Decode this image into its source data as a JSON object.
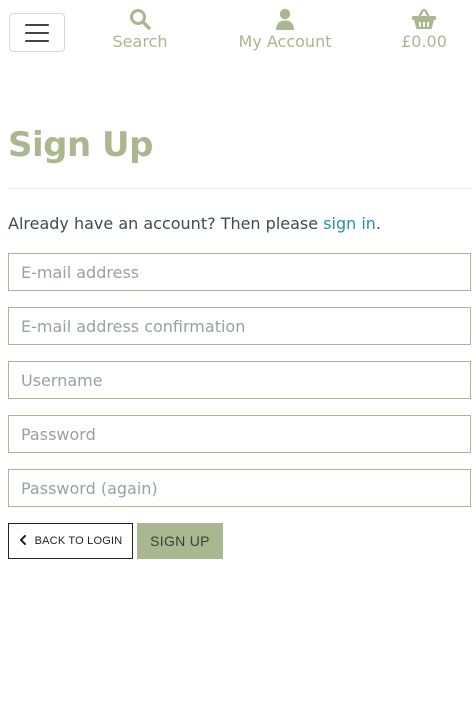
{
  "colors": {
    "accent": "#aab790",
    "link": "#2c8fa8",
    "text": "#3f4a52"
  },
  "nav": {
    "menu_icon": "hamburger-icon",
    "search": {
      "icon": "search-icon",
      "label": "Search"
    },
    "account": {
      "icon": "user-icon",
      "label": "My Account"
    },
    "bag": {
      "icon": "basket-icon",
      "label": "£0.00"
    }
  },
  "page": {
    "title": "Sign Up",
    "intro_text": "Already have an account? Then please ",
    "intro_link": "sign in",
    "intro_end": "."
  },
  "form": {
    "email": {
      "placeholder": "E-mail address",
      "value": ""
    },
    "email_confirm": {
      "placeholder": "E-mail address confirmation",
      "value": ""
    },
    "username": {
      "placeholder": "Username",
      "value": ""
    },
    "password": {
      "placeholder": "Password",
      "value": ""
    },
    "password_again": {
      "placeholder": "Password (again)",
      "value": ""
    }
  },
  "buttons": {
    "back_icon": "chevron-left-icon",
    "back_label": "BACK TO LOGIN",
    "signup_label": "SIGN UP"
  }
}
